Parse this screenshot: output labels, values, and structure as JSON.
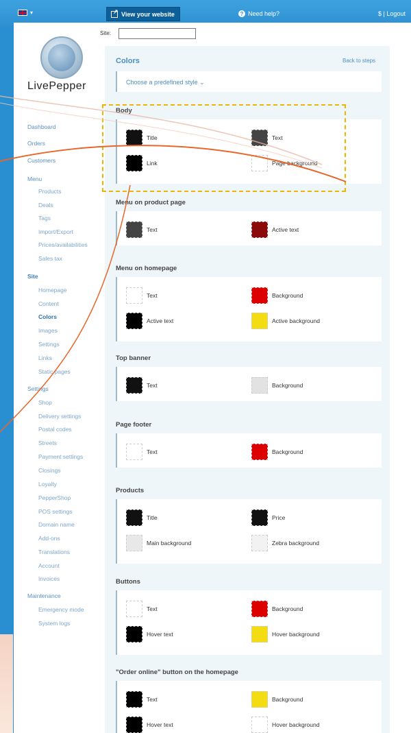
{
  "topbar": {
    "view_site": "View your website",
    "help": "Need help?",
    "logout": "$ | Logout"
  },
  "site_label": "Site:",
  "logo_text": "LivePepper",
  "nav": [
    {
      "label": "Dashboard",
      "kind": "top"
    },
    {
      "label": "Orders",
      "kind": "top"
    },
    {
      "label": "Customers",
      "kind": "top"
    },
    {
      "label": "Menu",
      "kind": "top"
    },
    {
      "label": "Products",
      "kind": "sub"
    },
    {
      "label": "Deals",
      "kind": "sub"
    },
    {
      "label": "Tags",
      "kind": "sub"
    },
    {
      "label": "Import/Export",
      "kind": "sub"
    },
    {
      "label": "Prices/availabilities",
      "kind": "sub"
    },
    {
      "label": "Sales tax",
      "kind": "sub"
    },
    {
      "label": "Site",
      "kind": "section"
    },
    {
      "label": "Homepage",
      "kind": "sub"
    },
    {
      "label": "Content",
      "kind": "sub"
    },
    {
      "label": "Colors",
      "kind": "active"
    },
    {
      "label": "Images",
      "kind": "sub"
    },
    {
      "label": "Settings",
      "kind": "sub"
    },
    {
      "label": "Links",
      "kind": "sub"
    },
    {
      "label": "Static pages",
      "kind": "sub"
    },
    {
      "label": "Settings",
      "kind": "top"
    },
    {
      "label": "Shop",
      "kind": "sub"
    },
    {
      "label": "Delivery settings",
      "kind": "sub"
    },
    {
      "label": "Postal codes",
      "kind": "sub"
    },
    {
      "label": "Streets",
      "kind": "sub"
    },
    {
      "label": "Payment settings",
      "kind": "sub"
    },
    {
      "label": "Closings",
      "kind": "sub"
    },
    {
      "label": "Loyalty",
      "kind": "sub"
    },
    {
      "label": "PepperShop",
      "kind": "sub"
    },
    {
      "label": "POS settings",
      "kind": "sub"
    },
    {
      "label": "Domain name",
      "kind": "sub"
    },
    {
      "label": "Add-ons",
      "kind": "sub"
    },
    {
      "label": "Translations",
      "kind": "sub"
    },
    {
      "label": "Account",
      "kind": "sub"
    },
    {
      "label": "Invoices",
      "kind": "sub"
    },
    {
      "label": "Maintenance",
      "kind": "top"
    },
    {
      "label": "Emergency mode",
      "kind": "sub"
    },
    {
      "label": "System logs",
      "kind": "sub"
    }
  ],
  "main": {
    "title": "Colors",
    "back": "Back to steps",
    "predefined": "Choose a predefined style ⌄"
  },
  "sections": [
    {
      "title": "Body",
      "items": [
        {
          "label": "Title",
          "color": "#111111"
        },
        {
          "label": "Text",
          "color": "#444444"
        },
        {
          "label": "Link",
          "color": "#000000"
        },
        {
          "label": "Page background",
          "color": "#ffffff"
        }
      ]
    },
    {
      "title": "Menu on product page",
      "items": [
        {
          "label": "Text",
          "color": "#444444"
        },
        {
          "label": "Active text",
          "color": "#8b0a0a"
        }
      ]
    },
    {
      "title": "Menu on homepage",
      "items": [
        {
          "label": "Text",
          "color": "#ffffff"
        },
        {
          "label": "Background",
          "color": "#dd0000"
        },
        {
          "label": "Active text",
          "color": "#000000"
        },
        {
          "label": "Active background",
          "color": "#f4dc12"
        }
      ]
    },
    {
      "title": "Top banner",
      "items": [
        {
          "label": "Text",
          "color": "#111111"
        },
        {
          "label": "Background",
          "color": "#e2e2e2"
        }
      ]
    },
    {
      "title": "Page footer",
      "items": [
        {
          "label": "Text",
          "color": "#ffffff"
        },
        {
          "label": "Background",
          "color": "#dd0000"
        }
      ]
    },
    {
      "title": "Products",
      "items": [
        {
          "label": "Title",
          "color": "#111111"
        },
        {
          "label": "Price",
          "color": "#111111"
        },
        {
          "label": "Main background",
          "color": "#e8e8e8"
        },
        {
          "label": "Zebra background",
          "color": "#f2f2f2"
        }
      ]
    },
    {
      "title": "Buttons",
      "items": [
        {
          "label": "Text",
          "color": "#ffffff"
        },
        {
          "label": "Background",
          "color": "#dd0000"
        },
        {
          "label": "Hover text",
          "color": "#000000"
        },
        {
          "label": "Hover background",
          "color": "#f4dc12"
        }
      ]
    },
    {
      "title": "\"Order online\" button on the homepage",
      "items": [
        {
          "label": "Text",
          "color": "#000000"
        },
        {
          "label": "Background",
          "color": "#f4dc12"
        },
        {
          "label": "Hover text",
          "color": "#000000"
        },
        {
          "label": "Hover background",
          "color": "#ffffff"
        }
      ]
    }
  ]
}
